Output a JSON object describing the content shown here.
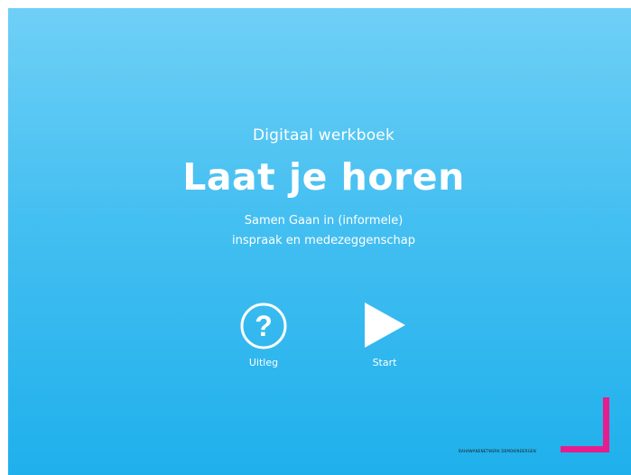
{
  "screen": {
    "subtitle": "Digitaal werkboek",
    "title": "Laat je horen",
    "tagline_line1": "Samen Gaan in (informele)",
    "tagline_line2": "inspraak en medezeggenschap"
  },
  "buttons": {
    "uitleg": {
      "label": "Uitleg",
      "icon": "question-circle-icon"
    },
    "start": {
      "label": "Start",
      "icon": "play-icon"
    }
  },
  "logo": {
    "text": "BAHAWANENETWERK DEMOKINDERGEN",
    "accent_color": "#e61d8c"
  },
  "colors": {
    "background_top": "#6fd0f6",
    "background_bottom": "#1fb0ec",
    "text": "#ffffff"
  }
}
